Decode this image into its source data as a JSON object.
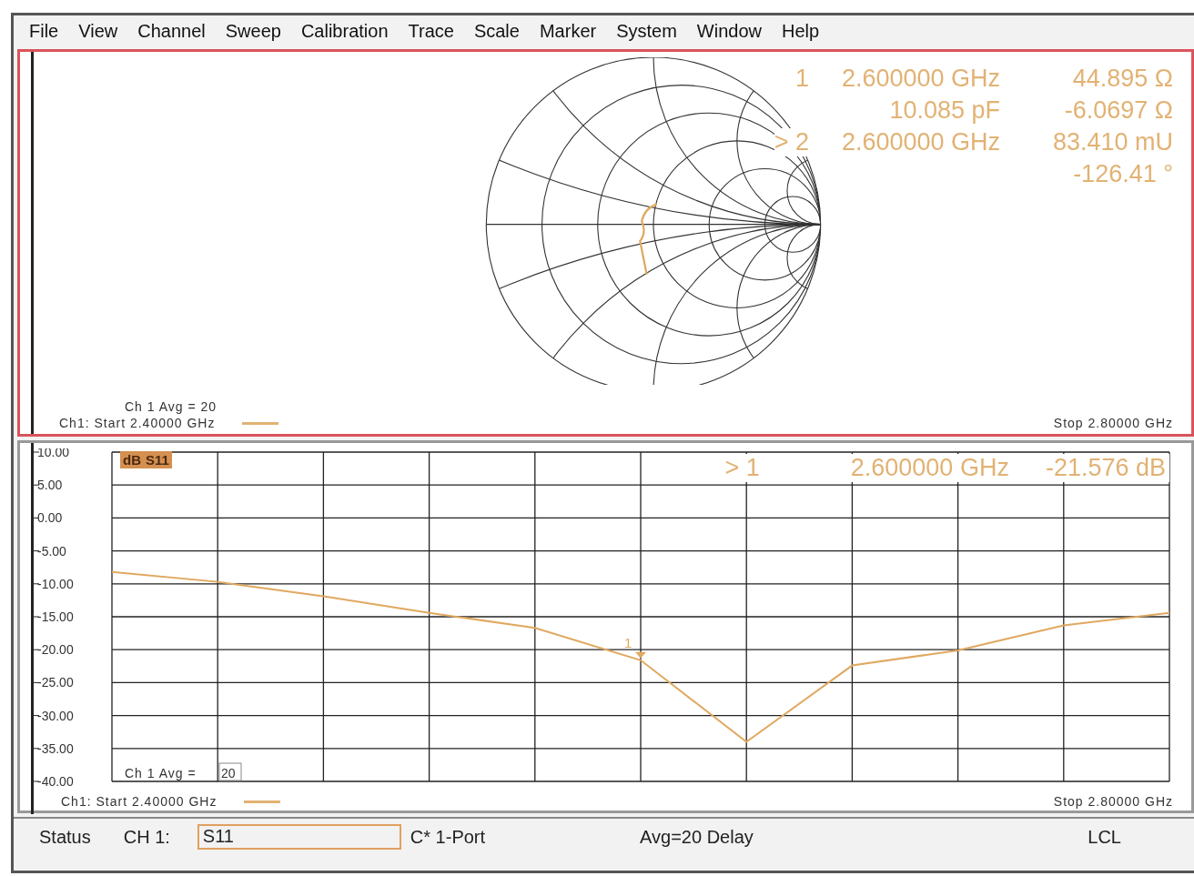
{
  "menu": [
    {
      "label": "File"
    },
    {
      "label": "View"
    },
    {
      "label": "Channel"
    },
    {
      "label": "Sweep"
    },
    {
      "label": "Calibration"
    },
    {
      "label": "Trace"
    },
    {
      "label": "Scale"
    },
    {
      "label": "Marker"
    },
    {
      "label": "System"
    },
    {
      "label": "Window"
    },
    {
      "label": "Help"
    }
  ],
  "panes": [
    {
      "kind": "smith",
      "active": true,
      "readout": [
        {
          "marker": "1",
          "left": "2.600000 GHz",
          "right": "44.895 Ω"
        },
        {
          "left": "10.085 pF",
          "right": "-6.0697 Ω"
        },
        {
          "marker": "> 2",
          "left": "2.600000 GHz",
          "right": "83.410 mU"
        },
        {
          "right": "-126.41 °"
        }
      ],
      "avg": "Ch 1 Avg =  20",
      "start": "Ch1: Start 2.40000 GHz",
      "stop": "Stop 2.80000 GHz"
    },
    {
      "kind": "logmag",
      "active": false,
      "format": "dB",
      "readout": {
        "marker": "> 1",
        "left": "2.600000 GHz",
        "right": "-21.576 dB"
      },
      "avg_label": "Ch 1 Avg =",
      "avg_value": "20",
      "start": "Ch1: Start 2.40000 GHz",
      "stop": "Stop 2.80000 GHz",
      "chart_data": {
        "type": "line",
        "categories": [
          null,
          null,
          null,
          null,
          null,
          null,
          null,
          null,
          null,
          null,
          null
        ],
        "series": [
          {
            "name": "S11",
            "color": "#e0a860",
            "values": [
              -8.2,
              -9.7,
              -11.9,
              -14.4,
              -16.7,
              -21.6,
              -34,
              -22.4,
              -20.1,
              -16.3,
              -14.4
            ]
          }
        ],
        "ylim": [
          -40,
          10
        ],
        "yticks": [
          {
            "value": 10,
            "label": "10.00"
          },
          {
            "value": 5,
            "label": "5.00"
          },
          {
            "value": 0,
            "label": "0.00"
          },
          {
            "value": -5,
            "label": "-5.00"
          },
          {
            "value": -10,
            "label": "-10.00"
          },
          {
            "value": -15,
            "label": "-15.00"
          },
          {
            "value": -20,
            "label": "-20.00"
          },
          {
            "value": -25,
            "label": "-25.00"
          },
          {
            "value": -30,
            "label": "-30.00"
          },
          {
            "value": -35,
            "label": "-35.00"
          },
          {
            "value": -40,
            "label": "-40.00"
          }
        ],
        "grid": true,
        "annotations": [
          {
            "text": "1",
            "y": -21.6
          }
        ]
      }
    }
  ],
  "status": {
    "label": "Status",
    "channel": "CH 1:",
    "parameter": "S11",
    "calibration": "C* 1-Port",
    "averaging": "Avg=20 Delay",
    "mode": "LCL"
  }
}
